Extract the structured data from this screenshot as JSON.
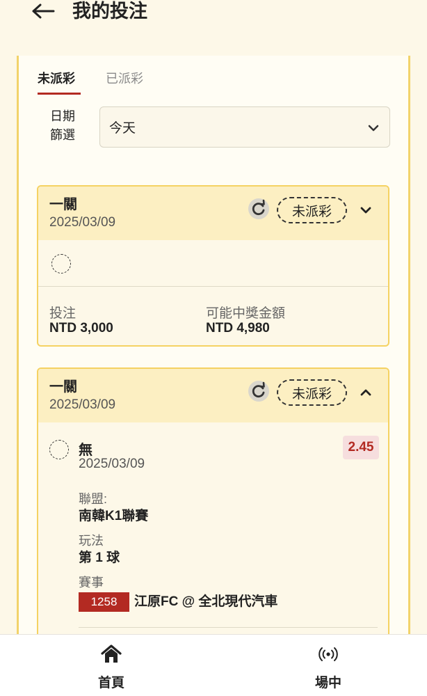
{
  "header": {
    "title": "我的投注"
  },
  "tabs": [
    {
      "label": "未派彩",
      "active": true
    },
    {
      "label": "已派彩",
      "active": false
    }
  ],
  "filter": {
    "label": "日期篩選",
    "label_line1": "日期",
    "label_line2": "篩選",
    "selected": "今天"
  },
  "bets": [
    {
      "type": "一關",
      "date": "2025/03/09",
      "status": "未派彩",
      "expanded": false,
      "stake_label": "投注",
      "stake": "NTD 3,000",
      "payout_label": "可能中獎金額",
      "payout": "NTD 4,980"
    },
    {
      "type": "一關",
      "date": "2025/03/09",
      "status": "未派彩",
      "expanded": true,
      "selection": {
        "name": "無",
        "date": "2025/03/09",
        "odds": "2.45",
        "league_label": "聯盟:",
        "league": "南韓K1聯賽",
        "market_label": "玩法",
        "market": "第 1 球",
        "event_label": "賽事",
        "event_id": "1258",
        "event": "江原FC @ 全北現代汽車"
      }
    }
  ],
  "nav": {
    "home": {
      "label": "首頁",
      "icon": "home-icon"
    },
    "live": {
      "label": "場中",
      "icon": "live-icon"
    }
  },
  "colors": {
    "accent": "#b32a22",
    "card_border": "#f5d262",
    "card_header": "#fcefc2",
    "background": "#fdf8e8"
  }
}
